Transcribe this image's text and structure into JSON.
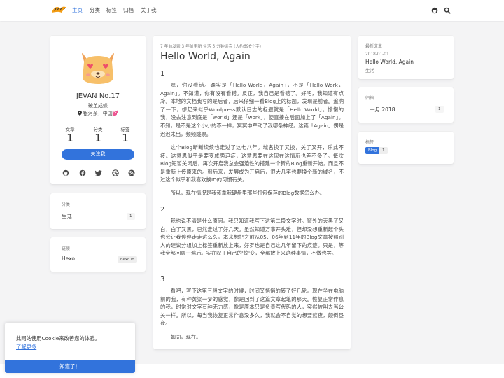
{
  "nav": {
    "items": [
      "主页",
      "分类",
      "标签",
      "归档",
      "关于我"
    ],
    "active": 0
  },
  "profile": {
    "name": "JEVAN No.17",
    "subtitle": "破茧成蝶",
    "location": "银河系，中国💕",
    "stats": [
      {
        "label": "文章",
        "value": "1"
      },
      {
        "label": "分类",
        "value": "1"
      },
      {
        "label": "标签",
        "value": "1"
      }
    ],
    "follow_label": "关注我",
    "social_icons": [
      "github-icon",
      "facebook-icon",
      "twitter-icon",
      "dribbble-icon",
      "rss-icon"
    ]
  },
  "categories_widget": {
    "title": "分类",
    "items": [
      {
        "label": "生活",
        "count": "1"
      }
    ]
  },
  "links_widget": {
    "title": "链接",
    "items": [
      {
        "label": "Hexo",
        "url": "hexo.io"
      }
    ]
  },
  "article": {
    "meta": "7 年前发表   3 年前更新   生活   5 分钟读完 (大约696个字)",
    "title": "Hello World, Again",
    "sections": [
      {
        "heading": "1",
        "paragraphs": [
          "嗯，你没看错。确实是「Hello World，Again」，不是「Hello Work，Again」。不知道，你有没有看错。反正，我自己是看错了。好吧，我知道有点冷。本地的文档我写的是后者，后来仔细一看Blog上的标题，发现是前者。追溯了一下，想起来似乎Wordpress默认日志的标题就是「Hello World」。愉懒的我，没去注意到底是「world」还是「work」，便直接在后面加上了「Again」。不知，是不是这个小小的不一样，冥冥中牵动了我哪条神经。这篇「Again」愣是迟迟未出，频频跳票。",
          "这个Blog断断续续也走过了这七八年。域名换了又换，关了又开，乐此不疲。这意思似乎是要变成强迫症，这意思要在这现在这情况也差不多了。每次Blog短暂关闭后，再次开启我总会强迫性的搭建一个新的Blog重新开始，而且不是重新上传原来的。到后来，发展成为开启后，很大几率也要换个新的域名，不过这个似乎和我喜欢换ID的习惯有关。",
          "所以，现在情况是我该拿我硬盘里那些打包保存的Blog数据怎么办。"
        ]
      },
      {
        "heading": "2",
        "paragraphs": [
          "我也说不清是什么原因。我只知道我写下这第二段文字时。窗外的天黑了又白，白了又黑，已然走过了好几天。虽然知道万事开头难，但却没想重新起个头也会让我停停走走这么久。本来想把之前从05、06年到11年的Blog文章按照别人的建议分组加上标签重新放上来，好歹也是自己这几年留下的痕迹。只是，等我全部回顾一遍后。实在叹于自己的'惊'变，全部放上来这种事情，不做也罢。"
        ]
      },
      {
        "heading": "3",
        "paragraphs": [
          "看吧，写下这第三段文字的时候，时间又悄悄的转了好几轮。现在坐在电脑前的我，有种黄粱一梦的感觉，像是回到了这篇文章起笔的那天。恢复正常作息的我，时常对文字有种无力感，像是原本只是负责写代码的人，突然被叫去当公关一样。所以，每当我恢复正常作息没多久，我就会不自觉的想要熬夜，颠倒昼夜。",
          "如同，现在。"
        ]
      }
    ]
  },
  "recent_widget": {
    "title": "最新文章",
    "date": "2018-01-01",
    "post_title": "Hello World, Again",
    "category": "生活"
  },
  "archive_widget": {
    "title": "归档",
    "items": [
      {
        "label": "一月 2018",
        "count": "1"
      }
    ]
  },
  "tags_widget": {
    "title": "标签",
    "items": [
      {
        "label": "Blog",
        "count": "1"
      }
    ]
  },
  "cookie": {
    "message": "此网站使用Cookie来改善您的体验。",
    "link": "了解更多",
    "button": "知道了！"
  },
  "colors": {
    "accent": "#3273dc",
    "background": "#f4f4f5",
    "card": "#ffffff"
  }
}
